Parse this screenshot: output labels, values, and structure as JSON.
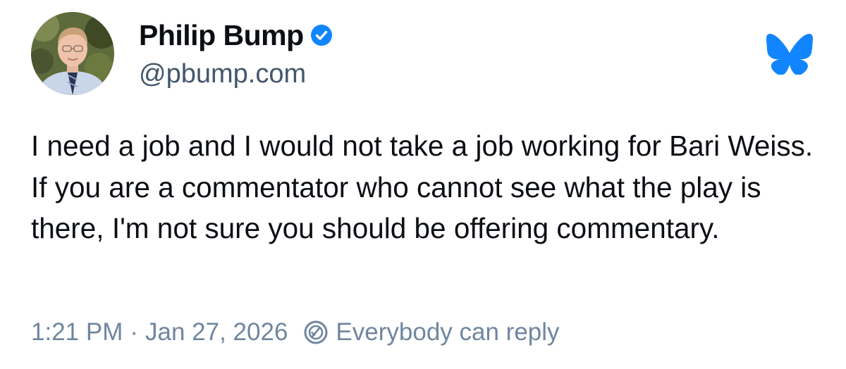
{
  "post": {
    "author": {
      "display_name": "Philip Bump",
      "handle": "@pbump.com",
      "verified": true
    },
    "text": "I need a job and I would not take a job working for Bari Weiss. If you are a commentator who cannot see what the play is there, I'm not sure you should be offering commentary.",
    "time": "1:21 PM",
    "separator": "·",
    "date": "Jan 27, 2026",
    "reply_setting": "Everybody can reply"
  },
  "icons": {
    "verified": "verified-badge-icon",
    "app_logo": "bluesky-butterfly-icon",
    "reply_setting": "reply-settings-icon"
  },
  "colors": {
    "brand_blue": "#1185fe",
    "text_primary": "#0b0f14",
    "text_secondary": "#42576c",
    "text_meta": "#6f869f"
  }
}
